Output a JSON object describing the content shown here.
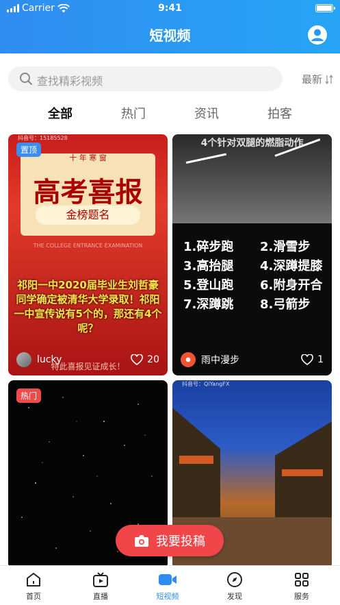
{
  "status_bar": {
    "carrier": "Carrier",
    "time": "9:41"
  },
  "nav": {
    "title": "短视频",
    "profile_icon": "user-circle-icon"
  },
  "search": {
    "placeholder": "查找精彩视频",
    "sort_label": "最新"
  },
  "tabs": [
    {
      "label": "全部",
      "active": true
    },
    {
      "label": "热门",
      "active": false
    },
    {
      "label": "资讯",
      "active": false
    },
    {
      "label": "拍客",
      "active": false
    }
  ],
  "cards": [
    {
      "badge": "置顶",
      "watermark": "抖音号：15185528",
      "poster_sub": "十 年 寒 窗",
      "poster_title": "高考喜报",
      "poster_band": "金榜题名",
      "poster_en": "THE COLLEGE ENTRANCE EXAMINATION",
      "caption": "祁阳一中2020届毕业生刘哲豪同学确定被清华大学录取！祁阳一中宣传说有5个的，那还有4个呢？",
      "poster_bottom": "特此喜报见证成长！",
      "author": "lucky",
      "likes": "20"
    },
    {
      "heading": "4个针对双腿的燃脂动作",
      "moves": [
        "1.碎步跑",
        "2.滑雪步",
        "3.高抬腿",
        "4.深蹲提膝",
        "5.登山跑",
        "6.附身开合",
        "7.深蹲跳",
        "8.弓箭步"
      ],
      "author": "雨中漫步",
      "likes": "1"
    },
    {
      "badge": "热门"
    },
    {
      "watermark": "抖音号：QiYangFX"
    }
  ],
  "cta": {
    "label": "我要投稿",
    "icon": "camera-icon"
  },
  "tabbar": [
    {
      "label": "首页",
      "icon": "home-icon"
    },
    {
      "label": "直播",
      "icon": "tv-icon"
    },
    {
      "label": "短视频",
      "icon": "video-camera-icon",
      "active": true
    },
    {
      "label": "发现",
      "icon": "compass-icon"
    },
    {
      "label": "服务",
      "icon": "grid-icon"
    }
  ],
  "colors": {
    "primary": "#2f8df0",
    "cta": "#f0464a",
    "badge_blue": "#3b8df2",
    "badge_red": "#f04b4b"
  }
}
